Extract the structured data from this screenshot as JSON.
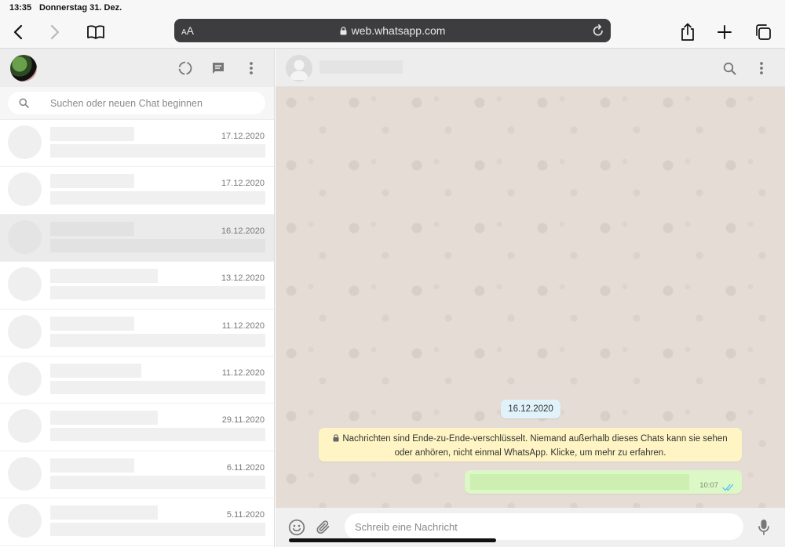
{
  "status_bar": {
    "time": "13:35",
    "date": "Donnerstag 31. Dez."
  },
  "browser": {
    "text_size_label_small": "A",
    "text_size_label_large": "A",
    "url": "web.whatsapp.com"
  },
  "sidebar": {
    "search_placeholder": "Suchen oder neuen Chat beginnen",
    "chats": [
      {
        "date": "17.12.2020",
        "selected": false
      },
      {
        "date": "17.12.2020",
        "selected": false
      },
      {
        "date": "16.12.2020",
        "selected": true
      },
      {
        "date": "13.12.2020",
        "selected": false
      },
      {
        "date": "11.12.2020",
        "selected": false
      },
      {
        "date": "11.12.2020",
        "selected": false
      },
      {
        "date": "29.11.2020",
        "selected": false
      },
      {
        "date": "6.11.2020",
        "selected": false
      },
      {
        "date": "5.11.2020",
        "selected": false
      }
    ]
  },
  "conversation": {
    "date_chip": "16.12.2020",
    "encryption_notice": "Nachrichten sind Ende-zu-Ende-verschlüsselt. Niemand außerhalb dieses Chats kann sie sehen oder anhören, nicht einmal WhatsApp. Klicke, um mehr zu erfahren.",
    "outgoing_message_time": "10:07",
    "compose_placeholder": "Schreib eine Nachricht"
  },
  "colors": {
    "chat_background": "#e5ddd5",
    "outgoing_bubble": "#dcf8c6",
    "date_chip": "#e1f2fb",
    "encryption_notice": "#fff5c4",
    "read_ticks": "#4fc3f7"
  }
}
